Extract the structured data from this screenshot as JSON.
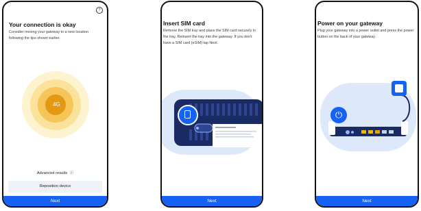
{
  "screen1": {
    "title": "Your connection is okay",
    "body": "Consider moving your gateway to a new location following the tips shown earlier.",
    "badge": "4G",
    "advanced_label": "Advanced results",
    "reposition_label": "Reposition device",
    "next_label": "Next",
    "help_glyph": "?"
  },
  "screen2": {
    "title": "Insert SIM card",
    "body": "Remove the SIM tray and place the SIM card securely in the tray. Reinsert the tray into the gateway. If you don't have a SIM card (eSIM) tap Next.",
    "next_label": "Next"
  },
  "screen3": {
    "title": "Power on your gateway",
    "body": "Plug your gateway into a power outlet and press the power button on the back of your gateway.",
    "next_label": "Next"
  },
  "colors": {
    "accent": "#1662f5",
    "ring_inner": "#e39a12",
    "ring_outer": "#fcefc0",
    "illustration_bg": "#dde9fb",
    "device": "#1a2a63"
  },
  "icons": [
    "help-icon",
    "info-icon",
    "sim-card-icon",
    "power-icon",
    "power-outlet-icon"
  ]
}
